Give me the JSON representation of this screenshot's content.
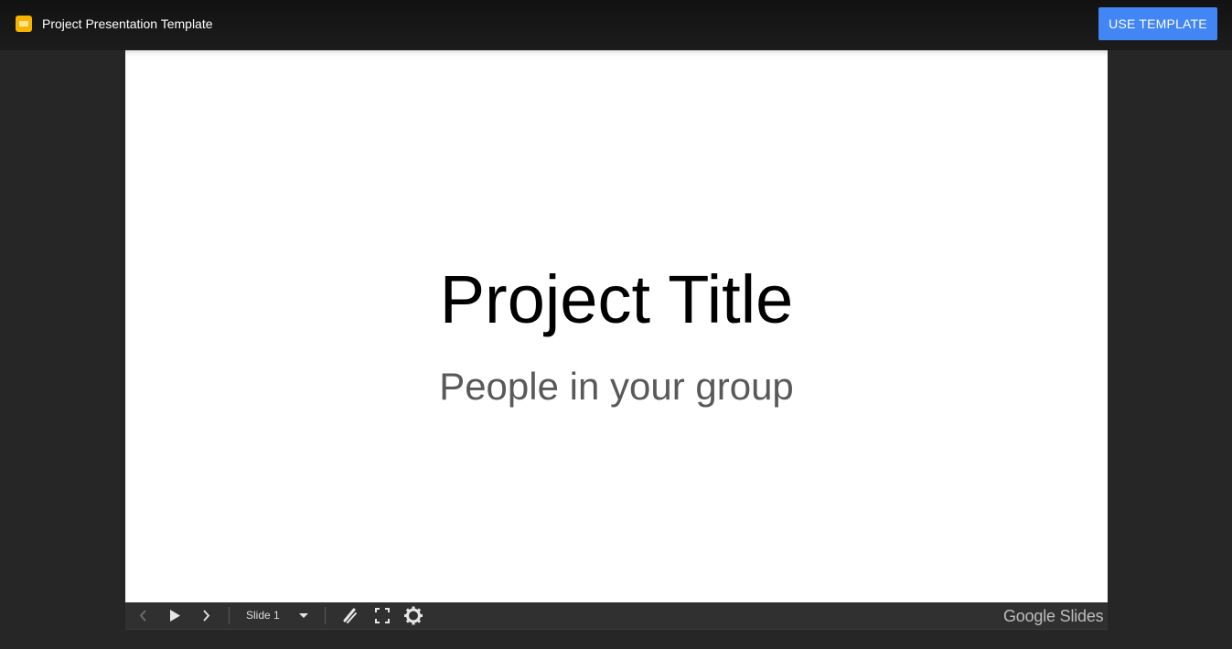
{
  "header": {
    "app_icon": "google-slides-icon",
    "title": "Project Presentation Template",
    "use_template_label": "USE TEMPLATE",
    "accent_color": "#4285f4",
    "icon_color": "#f4b400"
  },
  "slide": {
    "title": "Project Title",
    "subtitle": "People in your group"
  },
  "controls": {
    "previous_icon": "chevron-left-icon",
    "play_icon": "play-icon",
    "next_icon": "chevron-right-icon",
    "slide_selector_value": "Slide 1",
    "dropdown_icon": "caret-down-icon",
    "laser_icon": "laser-pointer-icon",
    "fullscreen_icon": "fullscreen-icon",
    "settings_icon": "gear-icon",
    "brand": "Google Slides"
  }
}
